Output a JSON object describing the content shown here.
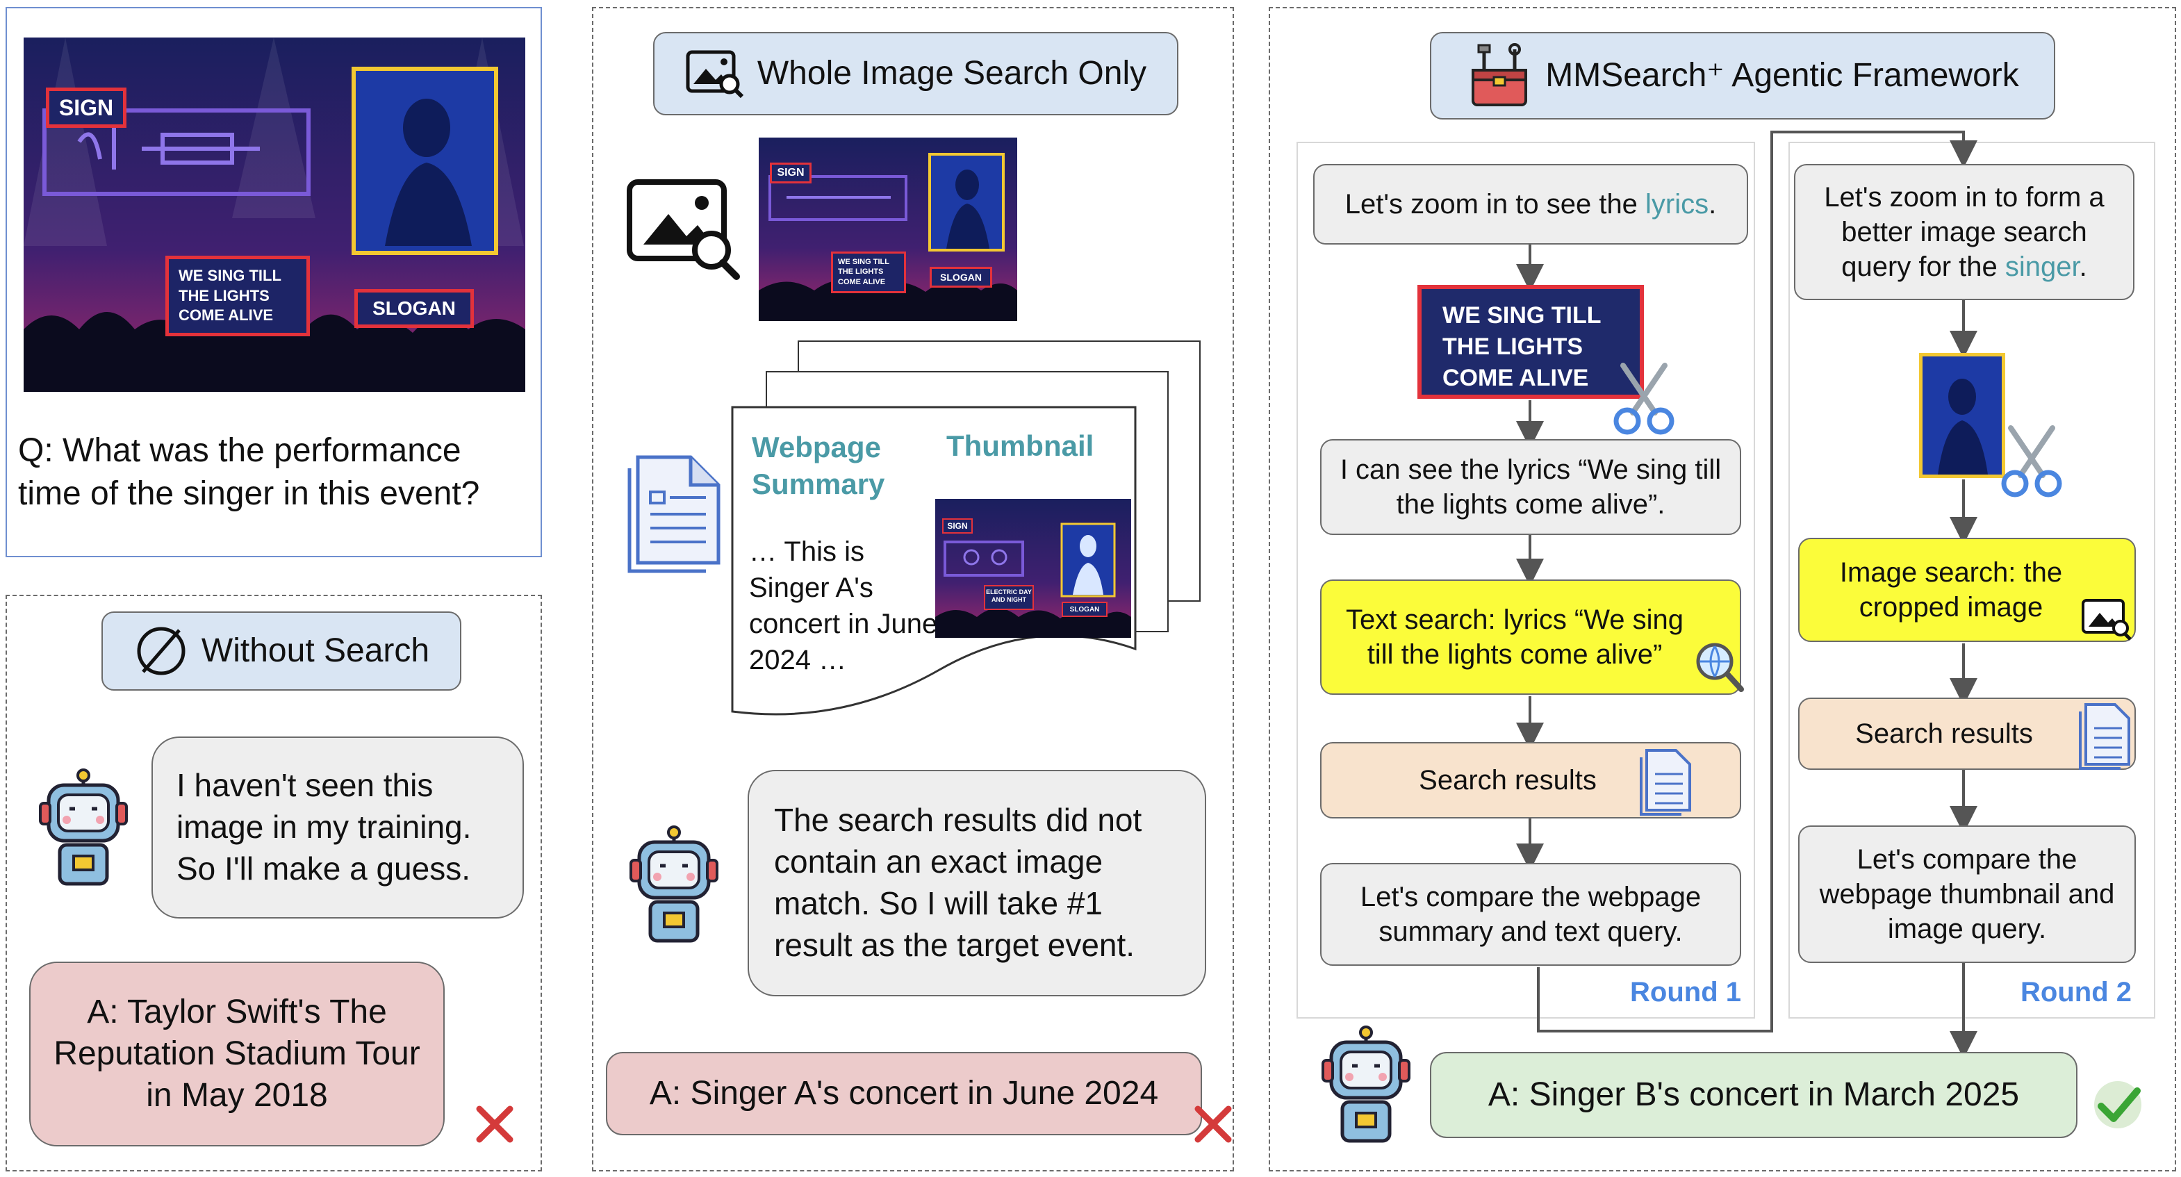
{
  "question": {
    "q_text": "Q: What was the performance time of the singer in this event?",
    "poster": {
      "sign": "SIGN",
      "slogan": "SLOGAN",
      "lyrics_line1": "WE SING TILL",
      "lyrics_line2": "THE LIGHTS",
      "lyrics_line3": "COME ALIVE"
    }
  },
  "without_search": {
    "title": "Without Search",
    "bubble": "I haven't seen this image in my training. So I'll make a guess.",
    "answer": "A: Taylor Swift's The Reputation Stadium Tour in May 2018"
  },
  "whole_image": {
    "title": "Whole Image Search Only",
    "webpage_summary_label": "Webpage Summary",
    "thumbnail_label": "Thumbnail",
    "summary_text": "… This is Singer A's concert in June 2024 …",
    "thumb_sign": "SIGN",
    "thumb_slogan": "SLOGAN",
    "thumb_electric": "ELECTRIC DAY AND NIGHT",
    "bubble": "The search results did not contain an exact image match. So I will take #1 result as the target event.",
    "answer": "A: Singer A's concert in June 2024"
  },
  "agentic": {
    "title": "MMSearch⁺ Agentic Framework",
    "round1": {
      "label": "Round 1",
      "step1_a": "Let's zoom in to see the ",
      "step1_b": "lyrics",
      "step1_c": ".",
      "crop_line1": "WE SING TILL",
      "crop_line2": "THE LIGHTS",
      "crop_line3": "COME ALIVE",
      "step2": "I can see the lyrics “We sing till the lights come alive”.",
      "step3": "Text search: lyrics “We sing till the lights come alive”",
      "step4": "Search results",
      "step5": "Let's compare the webpage summary and text query."
    },
    "round2": {
      "label": "Round 2",
      "step1_a": "Let's zoom in to form a better image search query for the ",
      "step1_b": "singer",
      "step1_c": ".",
      "step3": "Image search: the cropped image",
      "step4": "Search results",
      "step5": "Let's compare the webpage thumbnail and image query."
    },
    "answer": "A: Singer B's concert in March 2025"
  },
  "colors": {
    "teal": "#4a9aa6",
    "round_blue": "#4a86e0",
    "cross_red": "#d43a3a",
    "check_green": "#3aa535"
  }
}
